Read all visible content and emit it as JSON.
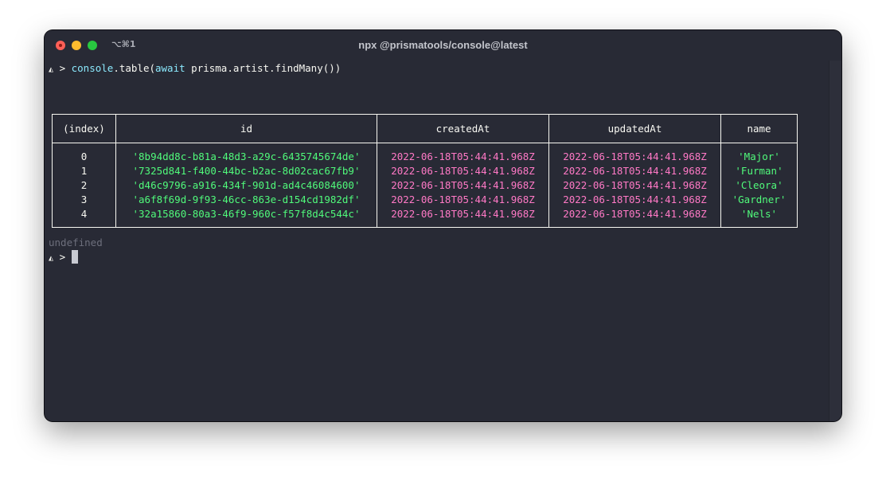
{
  "window": {
    "title": "npx @prismatools/console@latest",
    "shortcut": "⌥⌘1"
  },
  "prompt": {
    "symbol": "◭",
    "caret": ">",
    "command": {
      "fn": "console",
      "rest1": ".table(",
      "kw": "await",
      "rest2": " prisma.artist.findMany())"
    }
  },
  "table": {
    "headers": [
      "(index)",
      "id",
      "createdAt",
      "updatedAt",
      "name"
    ],
    "rows": [
      {
        "index": "0",
        "id": "'8b94dd8c-b81a-48d3-a29c-6435745674de'",
        "createdAt": "2022-06-18T05:44:41.968Z",
        "updatedAt": "2022-06-18T05:44:41.968Z",
        "name": "'Major'"
      },
      {
        "index": "1",
        "id": "'7325d841-f400-44bc-b2ac-8d02cac67fb9'",
        "createdAt": "2022-06-18T05:44:41.968Z",
        "updatedAt": "2022-06-18T05:44:41.968Z",
        "name": "'Furman'"
      },
      {
        "index": "2",
        "id": "'d46c9796-a916-434f-901d-ad4c46084600'",
        "createdAt": "2022-06-18T05:44:41.968Z",
        "updatedAt": "2022-06-18T05:44:41.968Z",
        "name": "'Cleora'"
      },
      {
        "index": "3",
        "id": "'a6f8f69d-9f93-46cc-863e-d154cd1982df'",
        "createdAt": "2022-06-18T05:44:41.968Z",
        "updatedAt": "2022-06-18T05:44:41.968Z",
        "name": "'Gardner'"
      },
      {
        "index": "4",
        "id": "'32a15860-80a3-46f9-960c-f57f8d4c544c'",
        "createdAt": "2022-06-18T05:44:41.968Z",
        "updatedAt": "2022-06-18T05:44:41.968Z",
        "name": "'Nels'"
      }
    ]
  },
  "output": {
    "result": "undefined"
  },
  "colors": {
    "background": "#282a35",
    "string": "#50fa7b",
    "date": "#ff79c6",
    "function": "#8be9fd"
  }
}
